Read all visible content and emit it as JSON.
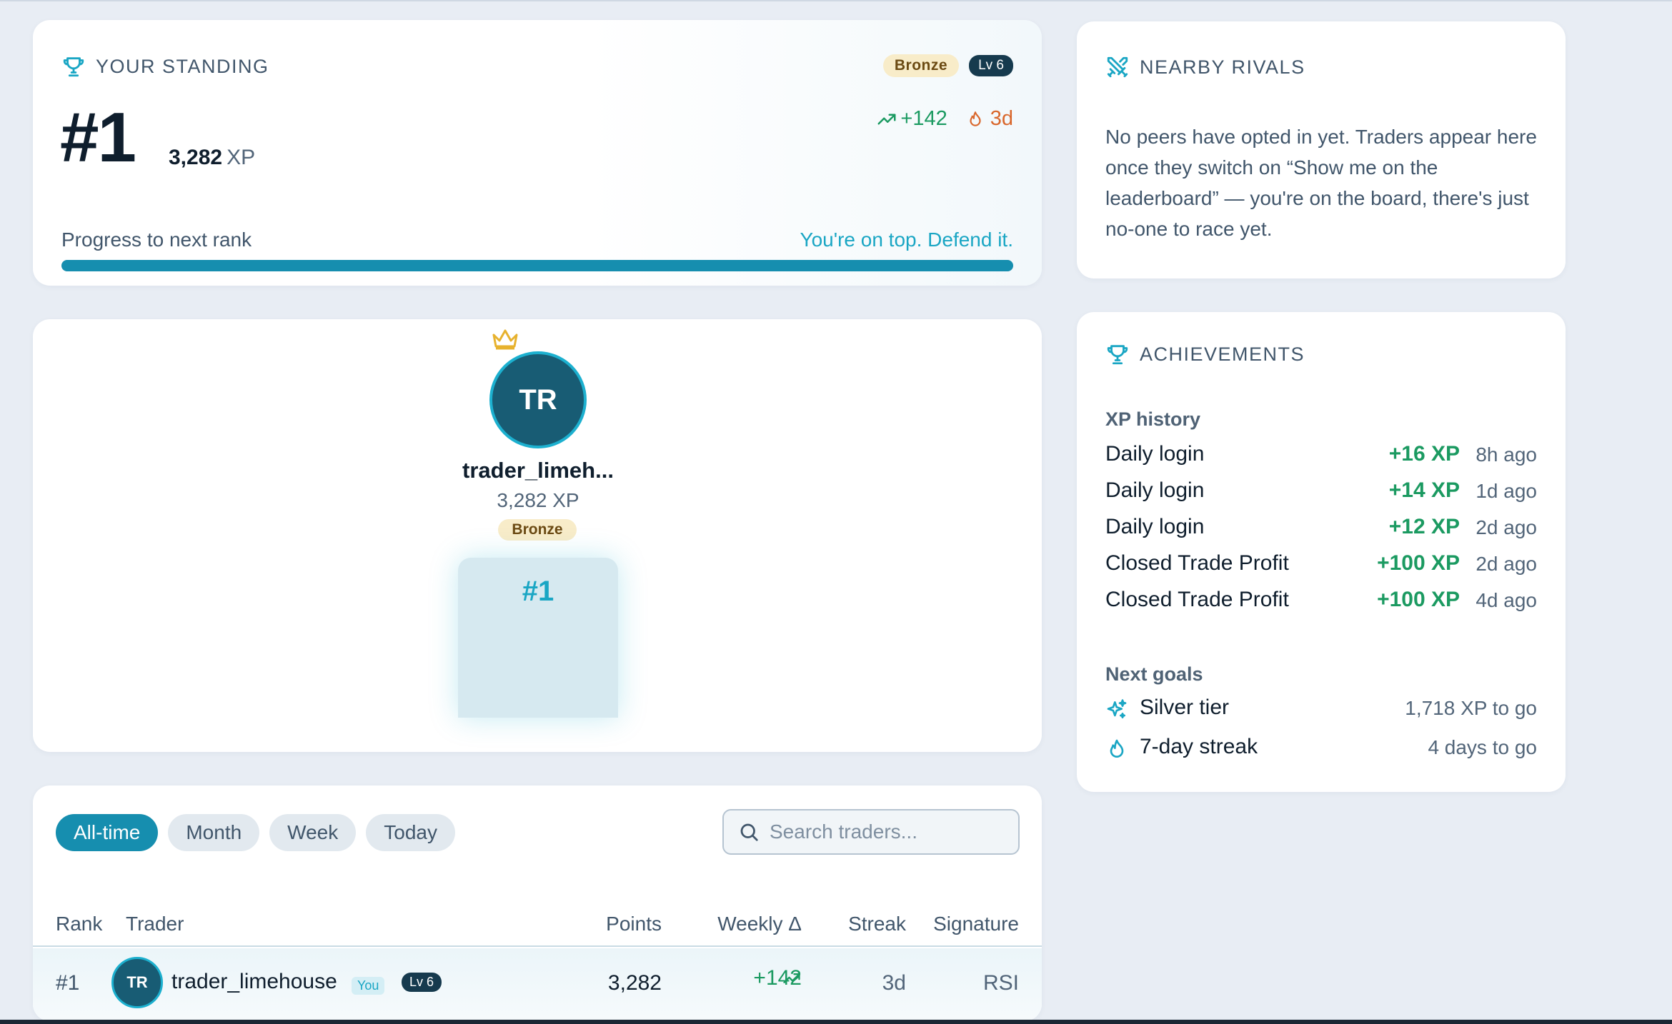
{
  "standing": {
    "title": "YOUR STANDING",
    "rank": "#1",
    "xp_value": "3,282",
    "xp_unit": "XP",
    "tier": "Bronze",
    "level": "Lv 6",
    "weekly_delta": "+142",
    "streak": "3d",
    "progress_label": "Progress to next rank",
    "progress_message": "You're on top. Defend it.",
    "progress_fraction": 1.0
  },
  "podium": {
    "initials": "TR",
    "name": "trader_limeh...",
    "xp": "3,282 XP",
    "tier": "Bronze",
    "rank": "#1"
  },
  "leaderboard": {
    "tabs": [
      "All-time",
      "Month",
      "Week",
      "Today"
    ],
    "active_tab": "All-time",
    "search_placeholder": "Search traders...",
    "columns": [
      "Rank",
      "Trader",
      "Points",
      "Weekly Δ",
      "Streak",
      "Signature"
    ],
    "rows": [
      {
        "rank": "#1",
        "initials": "TR",
        "trader": "trader_limehouse",
        "you_badge": "You",
        "level": "Lv 6",
        "points": "3,282",
        "weekly": "+142",
        "streak": "3d",
        "signature": "RSI"
      }
    ]
  },
  "rivals": {
    "title": "NEARBY RIVALS",
    "empty_text": "No peers have opted in yet. Traders appear here once they switch on “Show me on the leaderboard” — you're on the board, there's just no-one to race yet."
  },
  "achievements": {
    "title": "ACHIEVEMENTS",
    "history_heading": "XP history",
    "history": [
      {
        "label": "Daily login",
        "points": "+16 XP",
        "ago": "8h ago"
      },
      {
        "label": "Daily login",
        "points": "+14 XP",
        "ago": "1d ago"
      },
      {
        "label": "Daily login",
        "points": "+12 XP",
        "ago": "2d ago"
      },
      {
        "label": "Closed Trade Profit",
        "points": "+100 XP",
        "ago": "2d ago"
      },
      {
        "label": "Closed Trade Profit",
        "points": "+100 XP",
        "ago": "4d ago"
      }
    ],
    "goals_heading": "Next goals",
    "goals": [
      {
        "icon": "sparkles-icon",
        "label": "Silver tier",
        "remaining": "1,718 XP to go"
      },
      {
        "icon": "flame-icon",
        "label": "7-day streak",
        "remaining": "4 days to go"
      }
    ]
  },
  "colors": {
    "accent": "#168eaf",
    "positive": "#1b9a61",
    "streak": "#d9672c",
    "bronze_bg": "#f8ecc9"
  }
}
